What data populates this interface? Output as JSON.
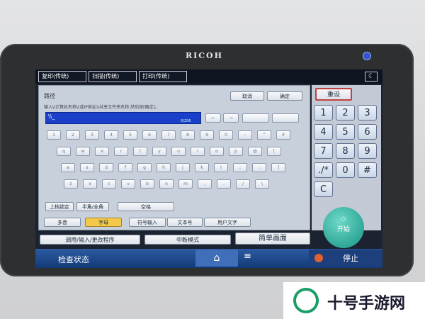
{
  "brand": {
    "logo": "RICOH"
  },
  "tabs": [
    "复印(传统)",
    "扫描(传统)",
    "打印(传统)"
  ],
  "path": {
    "label": "路径",
    "instruction": "输入\\\\计算机名称\\(或IP地址)\\共享文件夹名称,然后按[确定]。",
    "field_value": "\\\\_",
    "counter": "0/256"
  },
  "header_buttons": {
    "cancel": "取消",
    "ok": "确定"
  },
  "keyboard": {
    "row1": [
      "1",
      "2",
      "3",
      "4",
      "5",
      "6",
      "7",
      "8",
      "9",
      "0",
      "-",
      "^",
      "¥"
    ],
    "row2": [
      "q",
      "w",
      "e",
      "r",
      "t",
      "y",
      "u",
      "i",
      "o",
      "p",
      "@",
      "["
    ],
    "row3": [
      "a",
      "s",
      "d",
      "f",
      "g",
      "h",
      "j",
      "k",
      "l",
      ";",
      ":",
      "]"
    ],
    "row4": [
      "z",
      "x",
      "c",
      "v",
      "b",
      "n",
      "m",
      ",",
      ".",
      "/",
      "\\"
    ],
    "caps": "上档锁定",
    "halffull": "半角/全角",
    "space": "空格"
  },
  "mode_buttons": [
    "多音",
    "字母",
    "符号输入",
    "文本号",
    "用户文字"
  ],
  "bottom_row": {
    "program": "调用/输入/更改程序",
    "interrupt": "中断模式",
    "simple": "简单画面"
  },
  "numpad": {
    "reset": "重设",
    "keys": [
      "1",
      "2",
      "3",
      "4",
      "5",
      "6",
      "7",
      "8",
      "9",
      "./*",
      "0",
      "#",
      "C"
    ]
  },
  "start_label": "开始",
  "status_bar": {
    "check_status": "检查状态",
    "stop": "停止"
  },
  "watermark": {
    "text": "十号手游网"
  },
  "colors": {
    "accent": "#2d5aa0",
    "start": "#2fa898",
    "field": "#1a3fc8"
  }
}
